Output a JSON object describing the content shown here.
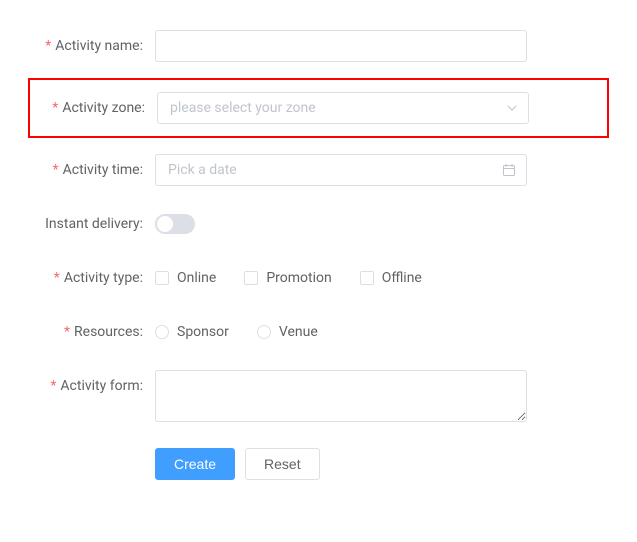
{
  "form": {
    "name": {
      "label": "Activity name",
      "value": ""
    },
    "zone": {
      "label": "Activity zone",
      "placeholder": "please select your zone",
      "selected": null
    },
    "time": {
      "label": "Activity time",
      "placeholder": "Pick a date",
      "value": ""
    },
    "instant": {
      "label": "Instant delivery",
      "value": false
    },
    "type": {
      "label": "Activity type",
      "options": [
        {
          "label": "Online",
          "checked": false
        },
        {
          "label": "Promotion",
          "checked": false
        },
        {
          "label": "Offline",
          "checked": false
        }
      ]
    },
    "resources": {
      "label": "Resources",
      "options": [
        {
          "label": "Sponsor",
          "selected": false
        },
        {
          "label": "Venue",
          "selected": false
        }
      ]
    },
    "formText": {
      "label": "Activity form",
      "value": ""
    }
  },
  "buttons": {
    "create": "Create",
    "reset": "Reset"
  },
  "colors": {
    "primary": "#409eff",
    "danger": "#f56c6c",
    "border": "#dcdfe6",
    "placeholder": "#c0c4cc",
    "highlight": "#ff0000"
  }
}
